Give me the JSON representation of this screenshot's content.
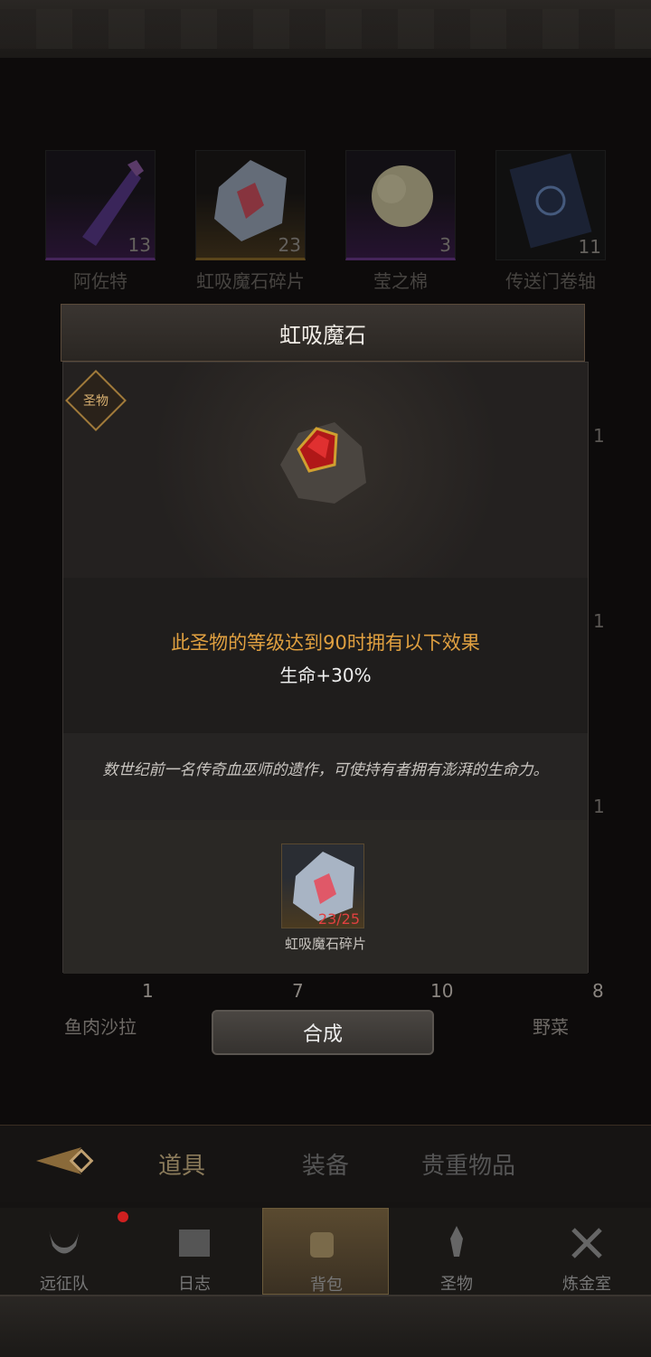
{
  "grid": {
    "top_row": [
      {
        "name": "阿佐特",
        "count": "13",
        "rarity": "purple",
        "icon": "potion-icon"
      },
      {
        "name": "虹吸魔石碎片",
        "count": "23",
        "rarity": "gold",
        "icon": "crystal-shard-icon"
      },
      {
        "name": "莹之棉",
        "count": "3",
        "rarity": "purple",
        "icon": "cotton-icon"
      },
      {
        "name": "传送门卷轴",
        "count": "11",
        "rarity": "none",
        "icon": "scroll-icon"
      }
    ],
    "side_counts": [
      "1",
      "1",
      "1"
    ],
    "bottom_row": [
      {
        "name": "鱼肉沙拉",
        "count": "1"
      },
      {
        "name": "",
        "count": "7"
      },
      {
        "name": "",
        "count": "10"
      },
      {
        "name": "野菜",
        "count": "8"
      }
    ]
  },
  "dialog": {
    "title": "虹吸魔石",
    "badge": "圣物",
    "effect_condition": "此圣物的等级达到90时拥有以下效果",
    "effect_value": "生命+30%",
    "description": "数世纪前一名传奇血巫师的遗作，可使持有者拥有澎湃的生命力。",
    "material": {
      "name": "虹吸魔石碎片",
      "progress": "23/25"
    },
    "combine_label": "合成"
  },
  "tabs": [
    {
      "label": "道具",
      "active": true
    },
    {
      "label": "装备",
      "active": false
    },
    {
      "label": "贵重物品",
      "active": false
    }
  ],
  "nav": [
    {
      "label": "远征队",
      "icon": "horned-helmet-icon",
      "badge": true
    },
    {
      "label": "日志",
      "icon": "journal-icon",
      "badge": false
    },
    {
      "label": "背包",
      "icon": "backpack-icon",
      "active": true
    },
    {
      "label": "圣物",
      "icon": "relic-icon",
      "badge": false
    },
    {
      "label": "炼金室",
      "icon": "alchemy-icon",
      "badge": false
    }
  ],
  "colors": {
    "effect_gold": "#e0a040",
    "shard_progress": "#e04040"
  }
}
